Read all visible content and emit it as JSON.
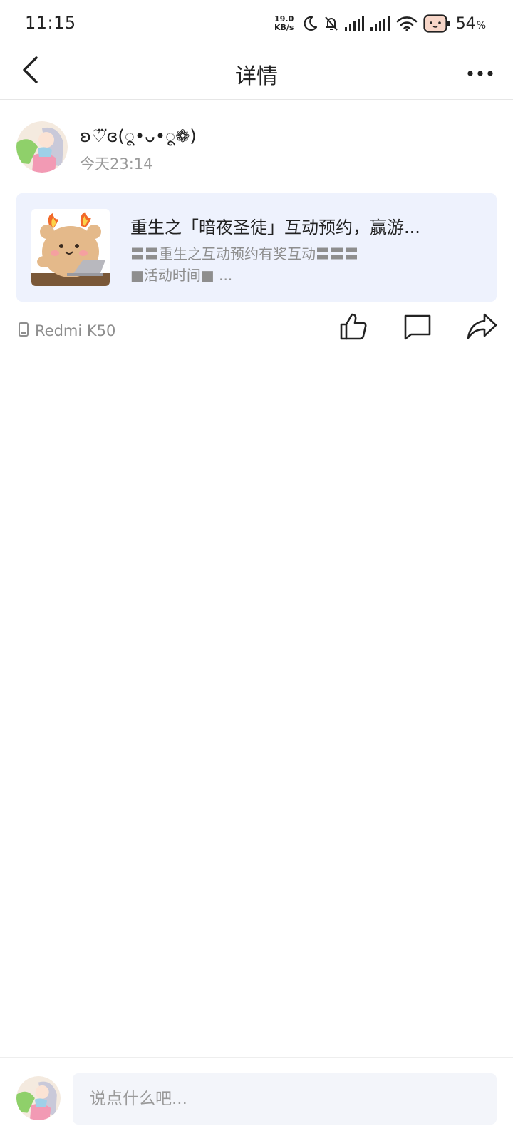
{
  "status_bar": {
    "time": "11:15",
    "net_speed_value": "19.0",
    "net_speed_unit": "KB/s",
    "battery_percent": "54",
    "battery_unit": "%",
    "icons": [
      "moon-icon",
      "bell-off-icon",
      "signal-icon",
      "signal-icon",
      "wifi-icon",
      "battery-icon"
    ]
  },
  "header": {
    "title": "详情",
    "back_icon": "chevron-left-icon",
    "more_icon": "more-horizontal-icon"
  },
  "post": {
    "author_name": "ʚ♡⃛ɞ(ू•ᴗ•ू❁)",
    "time": "今天23:14",
    "device": "Redmi K50",
    "shared_card": {
      "title": "重生之「暗夜圣徒」互动预约，赢游...",
      "desc_line1": "〓〓重生之互动预约有奖互动〓〓〓",
      "desc_line2": "■活动时间■ ..."
    },
    "actions": [
      "like-icon",
      "comment-icon",
      "share-icon"
    ]
  },
  "comment_bar": {
    "placeholder": "说点什么吧..."
  },
  "colors": {
    "card_background": "#eef2fd",
    "secondary_text": "#9a9a9a",
    "input_background": "#f3f5fa"
  }
}
